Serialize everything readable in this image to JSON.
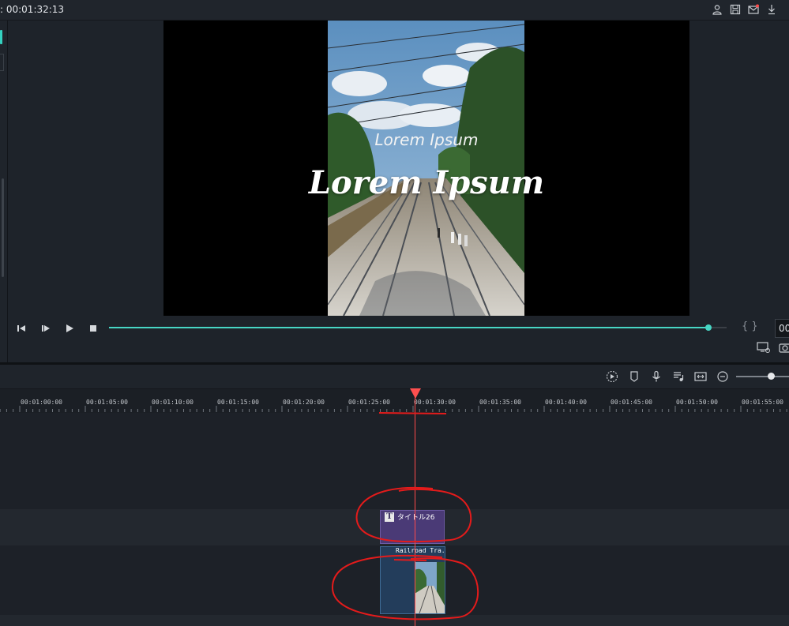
{
  "topbar": {
    "timecode": ": 00:01:32:13",
    "icons": [
      "account-icon",
      "save-icon",
      "mail-icon",
      "download-icon"
    ]
  },
  "preview": {
    "title_small": "Lorem Ipsum",
    "title_big": "Lorem Ipsum",
    "progress": 0.97,
    "time_display": "00",
    "brackets": "{  }"
  },
  "playback": {
    "buttons": [
      "step-back",
      "step-forward",
      "play",
      "stop"
    ]
  },
  "timeline_toolbar": {
    "icons": [
      "render-icon",
      "marker-icon",
      "microphone-icon",
      "audio-mix-icon",
      "fit-icon",
      "zoom-out-icon"
    ],
    "zoom_level": 0.67
  },
  "ruler": {
    "labels": [
      "00:01:00:00",
      "00:01:05:00",
      "00:01:10:00",
      "00:01:15:00",
      "00:01:20:00",
      "00:01:25:00",
      "00:01:30:00",
      "00:01:35:00",
      "00:01:40:00",
      "00:01:45:00",
      "00:01:50:00",
      "00:01:55:00"
    ]
  },
  "clips": {
    "title_clip_label": "タイトル26",
    "title_clip_icon": "T",
    "video_clip_label": "Railroad Tra..."
  },
  "colors": {
    "accent": "#47d6c4",
    "playhead": "#ff4a4a",
    "title_clip": "#4a3a76",
    "video_clip": "#233d5b",
    "annotation": "#e41b1b"
  }
}
